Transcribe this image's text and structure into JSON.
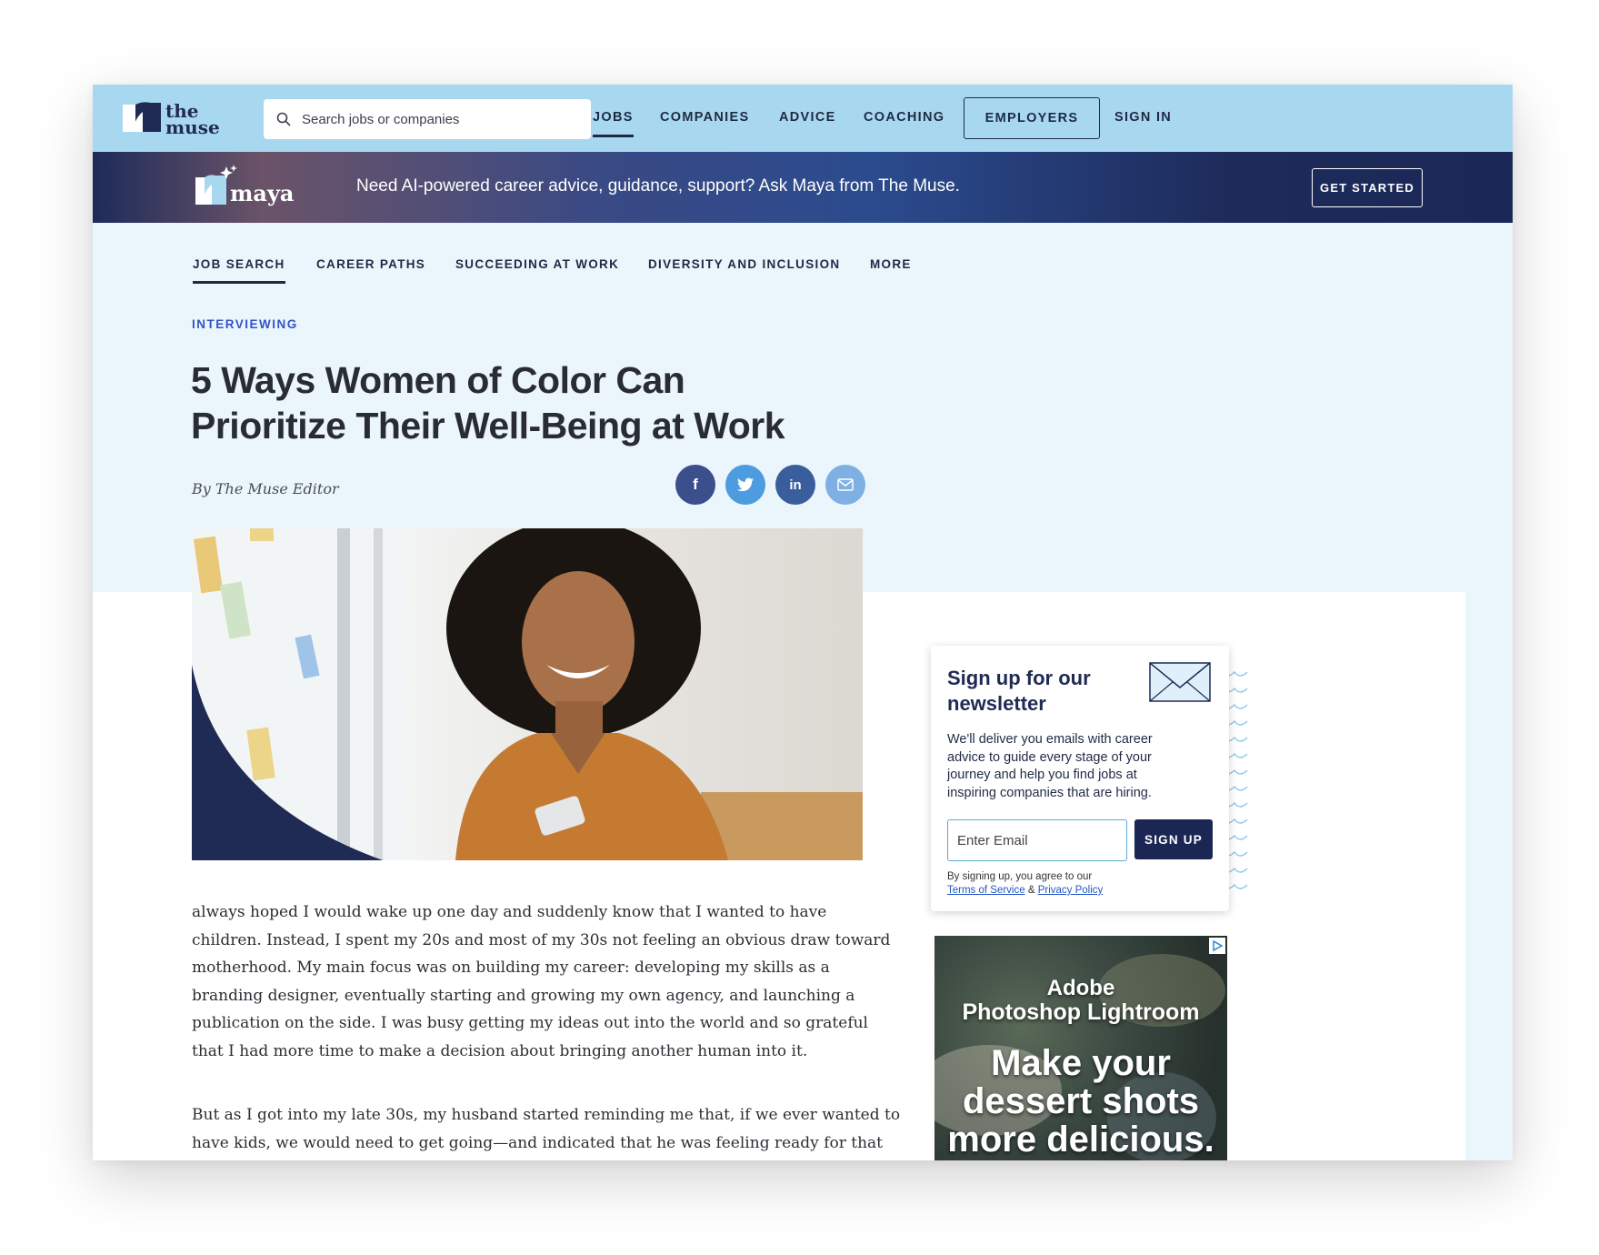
{
  "nav": {
    "logo_alt": "the muse",
    "search_placeholder": "Search jobs or companies",
    "links": [
      "JOBS",
      "COMPANIES",
      "ADVICE",
      "COACHING"
    ],
    "employers": "EMPLOYERS",
    "sign_in": "SIGN IN"
  },
  "maya": {
    "logo_text": "maya",
    "message": "Need AI-powered career advice, guidance, support? Ask Maya from The Muse.",
    "cta": "GET STARTED"
  },
  "subnav": [
    "JOB SEARCH",
    "CAREER PATHS",
    "SUCCEEDING AT WORK",
    "DIVERSITY AND INCLUSION",
    "MORE"
  ],
  "article": {
    "category": "INTERVIEWING",
    "title_line1": "5 Ways Women of Color Can",
    "title_line2": "Prioritize Their Well-Being at Work",
    "byline": "By The Muse Editor",
    "paragraph1": " always hoped I would wake up one day and suddenly know that I wanted to have children. Instead, I spent my 20s and most of my 30s not feeling an obvious draw toward motherhood. My main focus was on building my career: developing my skills as a branding designer, eventually starting and growing my own agency, and launching a publication on the side. I was busy getting my ideas out into the world and so grateful that I had more time to make a decision about bringing another human into it.",
    "paragraph2": "But as I got into my late 30s, my husband started reminding me that, if we ever wanted to have kids, we would need to get going—and indicated that he was feeling ready for that next"
  },
  "share": {
    "facebook": "f",
    "linkedin": "in"
  },
  "newsletter": {
    "title": "Sign up for our newsletter",
    "description": "We'll deliver you emails with career advice to guide every stage of your journey and help you find jobs at inspiring companies that are hiring.",
    "email_placeholder": "Enter Email",
    "button": "SIGN UP",
    "legal_prefix": "By signing up, you agree to our",
    "terms": "Terms of Service",
    "amp": "&",
    "privacy": "Privacy Policy"
  },
  "ad": {
    "brand_line1": "Adobe",
    "brand_line2": "Photoshop Lightroom",
    "headline1": "Make your",
    "headline2": "dessert shots",
    "headline3": "more delicious."
  },
  "colors": {
    "nav_bg": "#a8d8f0",
    "page_bg": "#ebf6fc",
    "navy": "#1f2a44",
    "accent_blue": "#3253c7"
  }
}
